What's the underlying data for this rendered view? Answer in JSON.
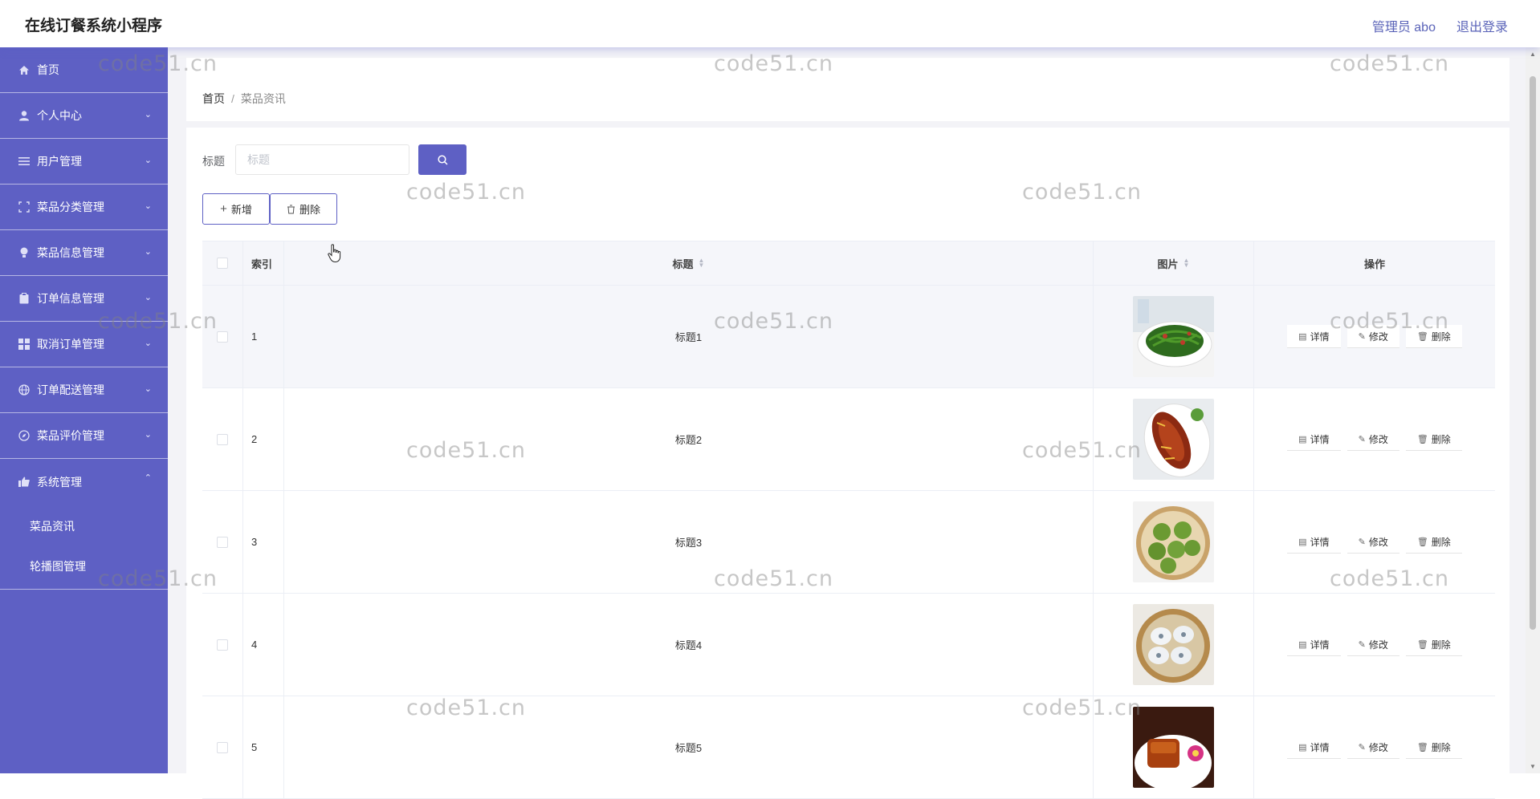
{
  "header": {
    "title": "在线订餐系统小程序",
    "user": "管理员 abo",
    "logout": "退出登录"
  },
  "sidebar": {
    "items": [
      {
        "label": "首页",
        "icon": "home-icon",
        "expandable": false
      },
      {
        "label": "个人中心",
        "icon": "user-icon",
        "expandable": true
      },
      {
        "label": "用户管理",
        "icon": "list-icon",
        "expandable": true
      },
      {
        "label": "菜品分类管理",
        "icon": "category-icon",
        "expandable": true
      },
      {
        "label": "菜品信息管理",
        "icon": "bulb-icon",
        "expandable": true
      },
      {
        "label": "订单信息管理",
        "icon": "clipboard-icon",
        "expandable": true
      },
      {
        "label": "取消订单管理",
        "icon": "grid-icon",
        "expandable": true
      },
      {
        "label": "订单配送管理",
        "icon": "globe-icon",
        "expandable": true
      },
      {
        "label": "菜品评价管理",
        "icon": "compass-icon",
        "expandable": true
      },
      {
        "label": "系统管理",
        "icon": "thumb-icon",
        "expandable": true,
        "expanded": true
      }
    ],
    "sub_items": [
      "菜品资讯",
      "轮播图管理"
    ]
  },
  "breadcrumb": {
    "home": "首页",
    "separator": "/",
    "current": "菜品资讯"
  },
  "search": {
    "label": "标题",
    "placeholder": "标题",
    "value": ""
  },
  "toolbar": {
    "add_label": "新增",
    "delete_label": "删除"
  },
  "table": {
    "columns": {
      "index": "索引",
      "title": "标题",
      "image": "图片",
      "actions": "操作"
    },
    "rows": [
      {
        "index": "1",
        "title": "标题1",
        "image": "green-beans-dish"
      },
      {
        "index": "2",
        "title": "标题2",
        "image": "braised-fish-dish"
      },
      {
        "index": "3",
        "title": "标题3",
        "image": "green-dumplings-dish"
      },
      {
        "index": "4",
        "title": "标题4",
        "image": "steamed-buns-dish"
      },
      {
        "index": "5",
        "title": "标题5",
        "image": "braised-pork-dish"
      }
    ],
    "actions": {
      "detail": "详情",
      "edit": "修改",
      "delete": "删除"
    }
  },
  "watermark": "code51.cn",
  "colors": {
    "primary": "#5e60c4",
    "header_user": "#5a63b8",
    "table_header": "#f5f6fa"
  }
}
